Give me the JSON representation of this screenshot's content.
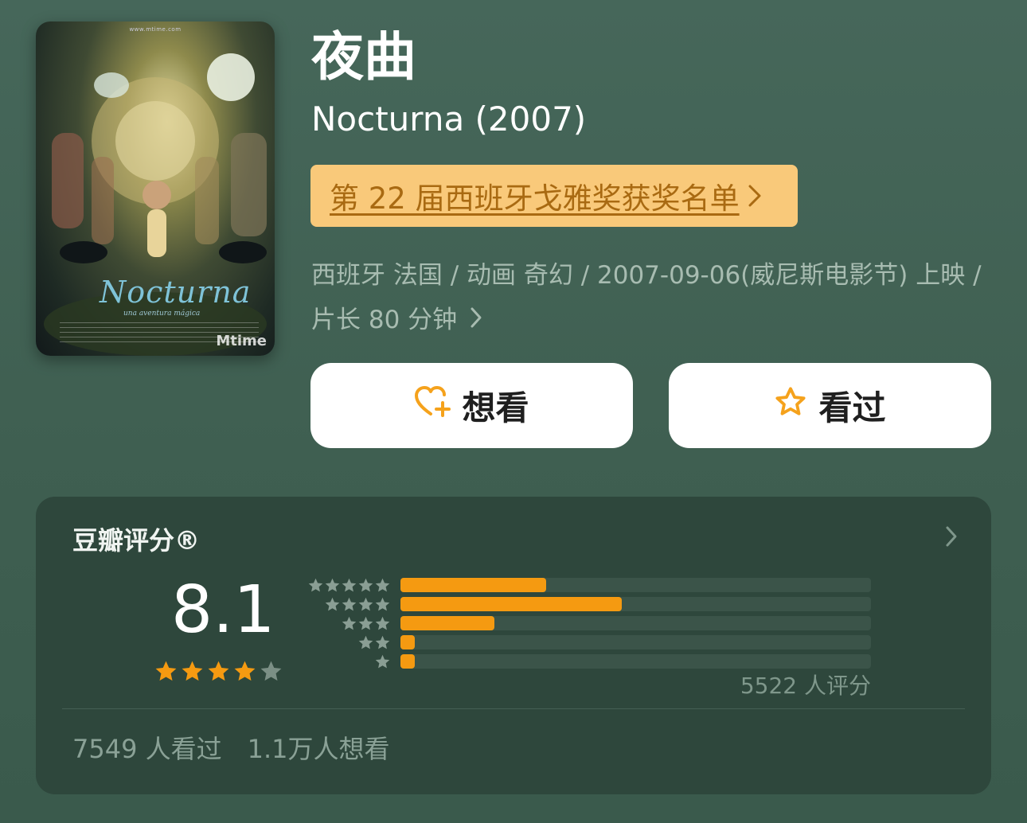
{
  "poster": {
    "site_text": "www.mtime.com",
    "title_art": "Nocturna",
    "subtitle_art": "una aventura mágica",
    "watermark": "Mtime"
  },
  "movie": {
    "title_cn": "夜曲",
    "title_en": "Nocturna (2007)",
    "award_link": "第 22 届西班牙戈雅奖获奖名单",
    "meta": "西班牙 法国 / 动画 奇幻 / 2007-09-06(威尼斯电影节) 上映 / 片长 80 分钟"
  },
  "actions": {
    "want_label": "想看",
    "want_icon": "heart-plus-icon",
    "seen_label": "看过",
    "seen_icon": "star-outline-icon"
  },
  "rating": {
    "title": "豆瓣评分®",
    "score": "8.1",
    "score_stars": 4,
    "rating_count": "5522 人评分",
    "watched": "7549 人看过",
    "wish": "1.1万人想看",
    "distribution": [
      {
        "stars": 5,
        "fraction": 0.31
      },
      {
        "stars": 4,
        "fraction": 0.47
      },
      {
        "stars": 3,
        "fraction": 0.2
      },
      {
        "stars": 2,
        "fraction": 0.03
      },
      {
        "stars": 1,
        "fraction": 0.03
      }
    ]
  },
  "colors": {
    "background": "#46675a",
    "card": "#2e473c",
    "accent": "#f59a11",
    "award_bg": "#f9c97a",
    "award_text": "#a96a12"
  }
}
